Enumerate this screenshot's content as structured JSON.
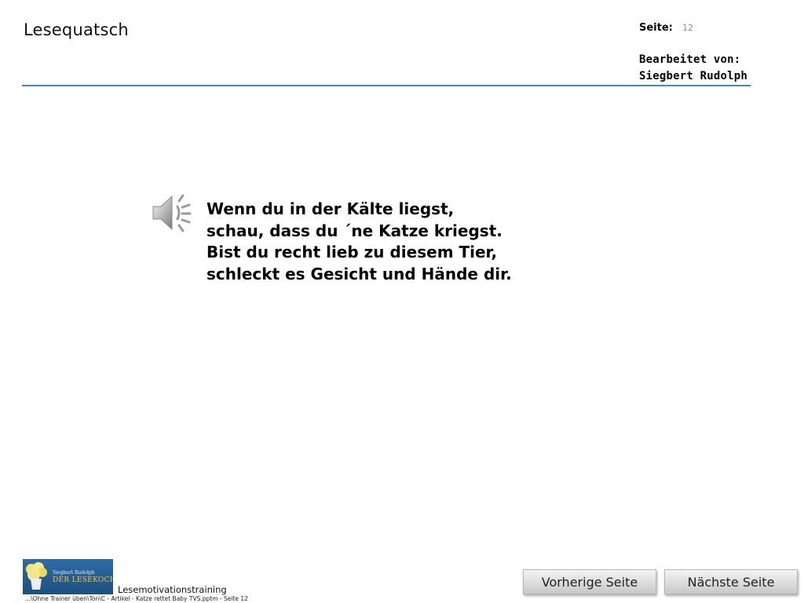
{
  "header": {
    "title": "Lesequatsch",
    "page_label": "Seite:",
    "page_number": "12",
    "editor_label": "Bearbeitet von:",
    "editor_name": "Siegbert Rudolph",
    "rule_color": "#4f81bd"
  },
  "content": {
    "audio_icon": "speaker-icon",
    "poem_lines": [
      "Wenn du in der Kälte liegst,",
      "schau, dass du ´ne Katze kriegst.",
      "Bist du recht lieb zu diesem Tier,",
      "schleckt es Gesicht und Hände dir."
    ]
  },
  "footer": {
    "logo_small_text": "Siegbert Rudolph",
    "logo_brand_text": "DER LESEKOCH",
    "title": "Lesemotivationstraining",
    "path": "...\\Ohne Trainer üben\\Ton\\C - Artikel - Katze rettet Baby TVS.pptm - Seite 12"
  },
  "nav": {
    "prev_label": "Vorherige Seite",
    "next_label": "Nächste Seite"
  }
}
